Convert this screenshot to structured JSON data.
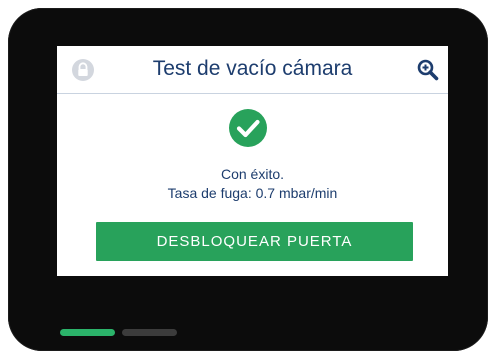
{
  "screen": {
    "title": "Test de vacío cámara",
    "status_icon": "check-circle-icon",
    "message_line1": "Con éxito.",
    "message_line2": "Tasa de fuga: 0.7 mbar/min",
    "unlock_button_label": "DESBLOQUEAR PUERTA"
  },
  "header": {
    "left_icon": "lock-icon",
    "right_icon": "magnifier-plus-icon"
  },
  "indicators": {
    "count": 2,
    "active_index": 0
  },
  "colors": {
    "bezel": "#0c0c0c",
    "title_text": "#1d3d6e",
    "success_green": "#28a25b",
    "indicator_active": "#2bb36a",
    "indicator_inactive": "#3c3c3c",
    "lock_icon_gray": "#c8cdd6"
  }
}
